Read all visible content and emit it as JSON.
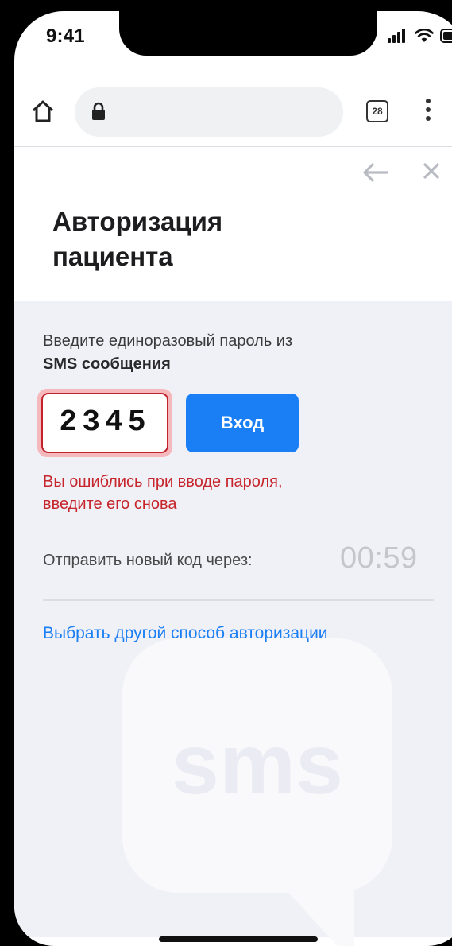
{
  "status_bar": {
    "time": "9:41"
  },
  "browser": {
    "tab_count": "28"
  },
  "header": {
    "title": "Авторизация пациента"
  },
  "form": {
    "instruction_line1": "Введите единоразовый пароль из",
    "instruction_line2": "SMS сообщения",
    "code_value": "2345",
    "login_label": "Вход",
    "error_line1": "Вы ошиблись при вводе пароля,",
    "error_line2": "введите его снова",
    "resend_label": "Отправить новый код через:",
    "timer": "00:59",
    "alt_auth_link": "Выбрать другой способ авторизации"
  },
  "background_graphic": {
    "label": "sms"
  },
  "colors": {
    "accent": "#1a7ef5",
    "error": "#c6252c",
    "content_bg": "#f0f1f6"
  },
  "icons": [
    "home-icon",
    "lock-icon",
    "tabs-icon",
    "more-vert-icon",
    "back-arrow-icon",
    "close-icon",
    "signal-icon",
    "wifi-icon",
    "battery-icon",
    "sms-bubble-icon"
  ]
}
